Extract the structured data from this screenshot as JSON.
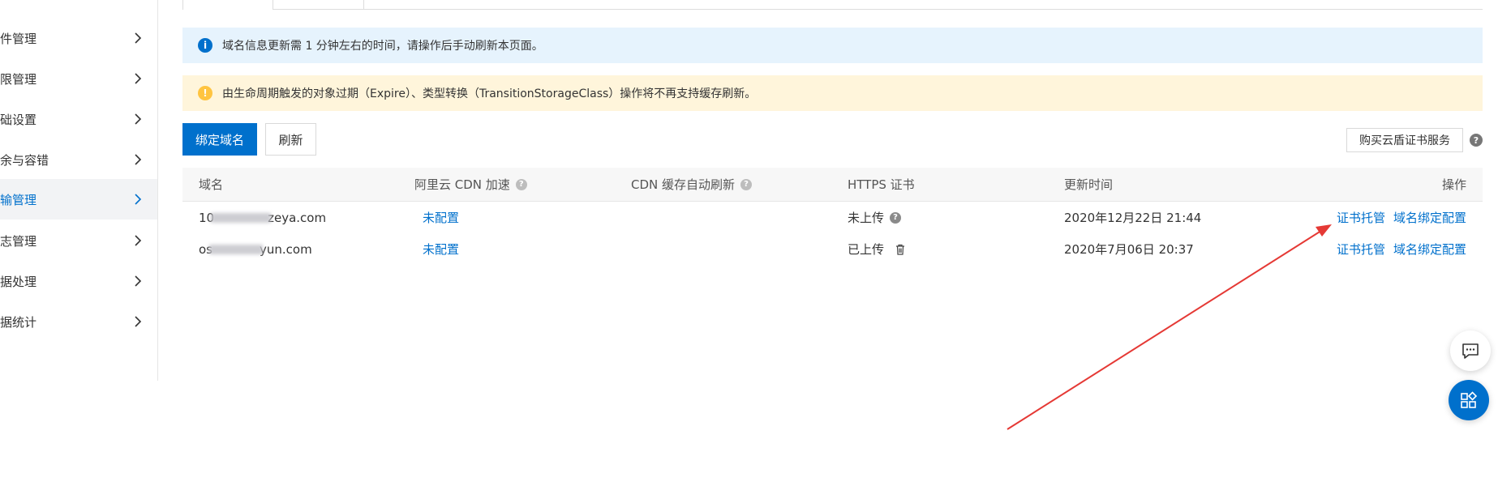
{
  "sidebar": {
    "items": [
      {
        "label": "文件管理"
      },
      {
        "label": "权限管理"
      },
      {
        "label": "基础设置"
      },
      {
        "label": "冗余与容错"
      },
      {
        "label": "传输管理",
        "active": true
      },
      {
        "label": "日志管理"
      },
      {
        "label": "数据处理"
      },
      {
        "label": "数据统计"
      }
    ]
  },
  "alerts": {
    "info": "域名信息更新需 1 分钟左右的时间，请操作后手动刷新本页面。",
    "warning": "由生命周期触发的对象过期（Expire）、类型转换（TransitionStorageClass）操作将不再支持缓存刷新。"
  },
  "toolbar": {
    "bind_label": "绑定域名",
    "refresh_label": "刷新",
    "buy_label": "购买云盾证书服务"
  },
  "table": {
    "headers": {
      "domain": "域名",
      "cdn": "阿里云 CDN 加速",
      "auto_refresh": "CDN 缓存自动刷新",
      "https": "HTTPS 证书",
      "updated": "更新时间",
      "actions": "操作"
    },
    "rows": [
      {
        "domain_prefix": "10",
        "domain_suffix": "zeya.com",
        "cdn": "未配置",
        "https": "未上传",
        "updated": "2020年12月22日 21:44",
        "action_cert": "证书托管",
        "action_bind": "域名绑定配置"
      },
      {
        "domain_prefix": "os",
        "domain_suffix": "yun.com",
        "cdn": "未配置",
        "https": "已上传",
        "updated": "2020年7月06日 20:37",
        "action_cert": "证书托管",
        "action_bind": "域名绑定配置"
      }
    ]
  },
  "colors": {
    "primary": "#0070cc",
    "info_bg": "#e6f3fd",
    "warning_bg": "#fff5db",
    "warning_icon": "#ffc440",
    "annotation_arrow": "#e53935"
  },
  "icons": {
    "info": "info-icon",
    "warning": "warning-icon",
    "help": "help-icon",
    "trash": "trash-icon",
    "chat": "chat-icon",
    "apps": "apps-icon",
    "chevron": "chevron-right-icon"
  }
}
